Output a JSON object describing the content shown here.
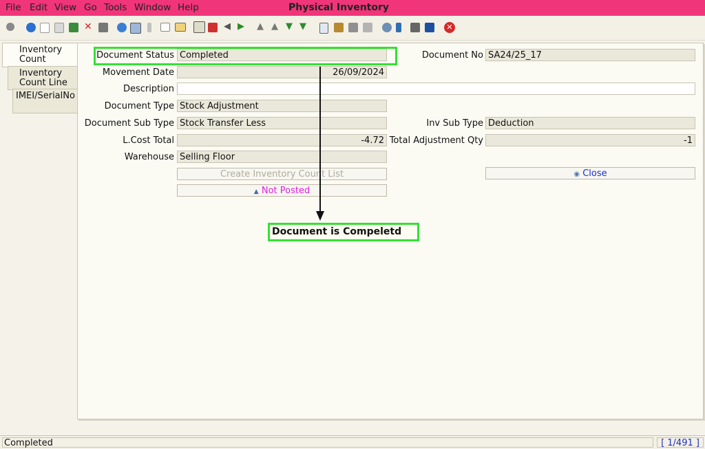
{
  "menu": {
    "file": "File",
    "edit": "Edit",
    "view": "View",
    "go": "Go",
    "tools": "Tools",
    "window": "Window",
    "help": "Help"
  },
  "window_title": "Physical Inventory",
  "toolbar_icons": [
    "undo-icon",
    "help-icon",
    "new-icon",
    "copy-icon",
    "save-icon",
    "delete-icon",
    "print-preview-icon",
    "refresh-icon",
    "find-icon",
    "attachment-icon",
    "chat-icon",
    "history-icon",
    "report-icon",
    "home-icon",
    "back-icon",
    "forward-icon",
    "first-record-icon",
    "previous-record-icon",
    "next-record-icon",
    "last-record-icon",
    "detail-icon",
    "archive-icon",
    "print-icon",
    "print-setup-icon",
    "zoom-icon",
    "workflow-icon",
    "product-icon",
    "window-icon",
    "exit-icon"
  ],
  "tabs": [
    {
      "line1": "Inventory",
      "line2": "Count"
    },
    {
      "line1": "Inventory",
      "line2": "Count Line"
    },
    {
      "line1": "IMEI/SerialNo",
      "line2": ""
    }
  ],
  "form": {
    "document_status_label": "Document Status",
    "document_status_value": "Completed",
    "document_no_label": "Document No",
    "document_no_value": "SA24/25_17",
    "movement_date_label": "Movement Date",
    "movement_date_value": "26/09/2024",
    "description_label": "Description",
    "description_value": "",
    "document_type_label": "Document Type",
    "document_type_value": "Stock Adjustment",
    "document_sub_type_label": "Document Sub Type",
    "document_sub_type_value": "Stock Transfer Less",
    "inv_sub_type_label": "Inv Sub Type",
    "inv_sub_type_value": "Deduction",
    "lcost_total_label": "L.Cost Total",
    "lcost_total_value": "-4.72",
    "total_adjustment_qty_label": "Total Adjustment Qty",
    "total_adjustment_qty_value": "-1",
    "warehouse_label": "Warehouse",
    "warehouse_value": "Selling Floor",
    "create_list_button": "Create Inventory Count List",
    "close_button": "Close",
    "not_posted_button": "Not Posted"
  },
  "annotation": "Document is Compeletd",
  "status": {
    "message": "Completed",
    "record": "[ 1/491 ]"
  },
  "colors": {
    "title_bar": "#f0357a",
    "highlight": "#35e034",
    "not_posted_text": "#e020e0",
    "close_text": "#1a2fd0"
  }
}
